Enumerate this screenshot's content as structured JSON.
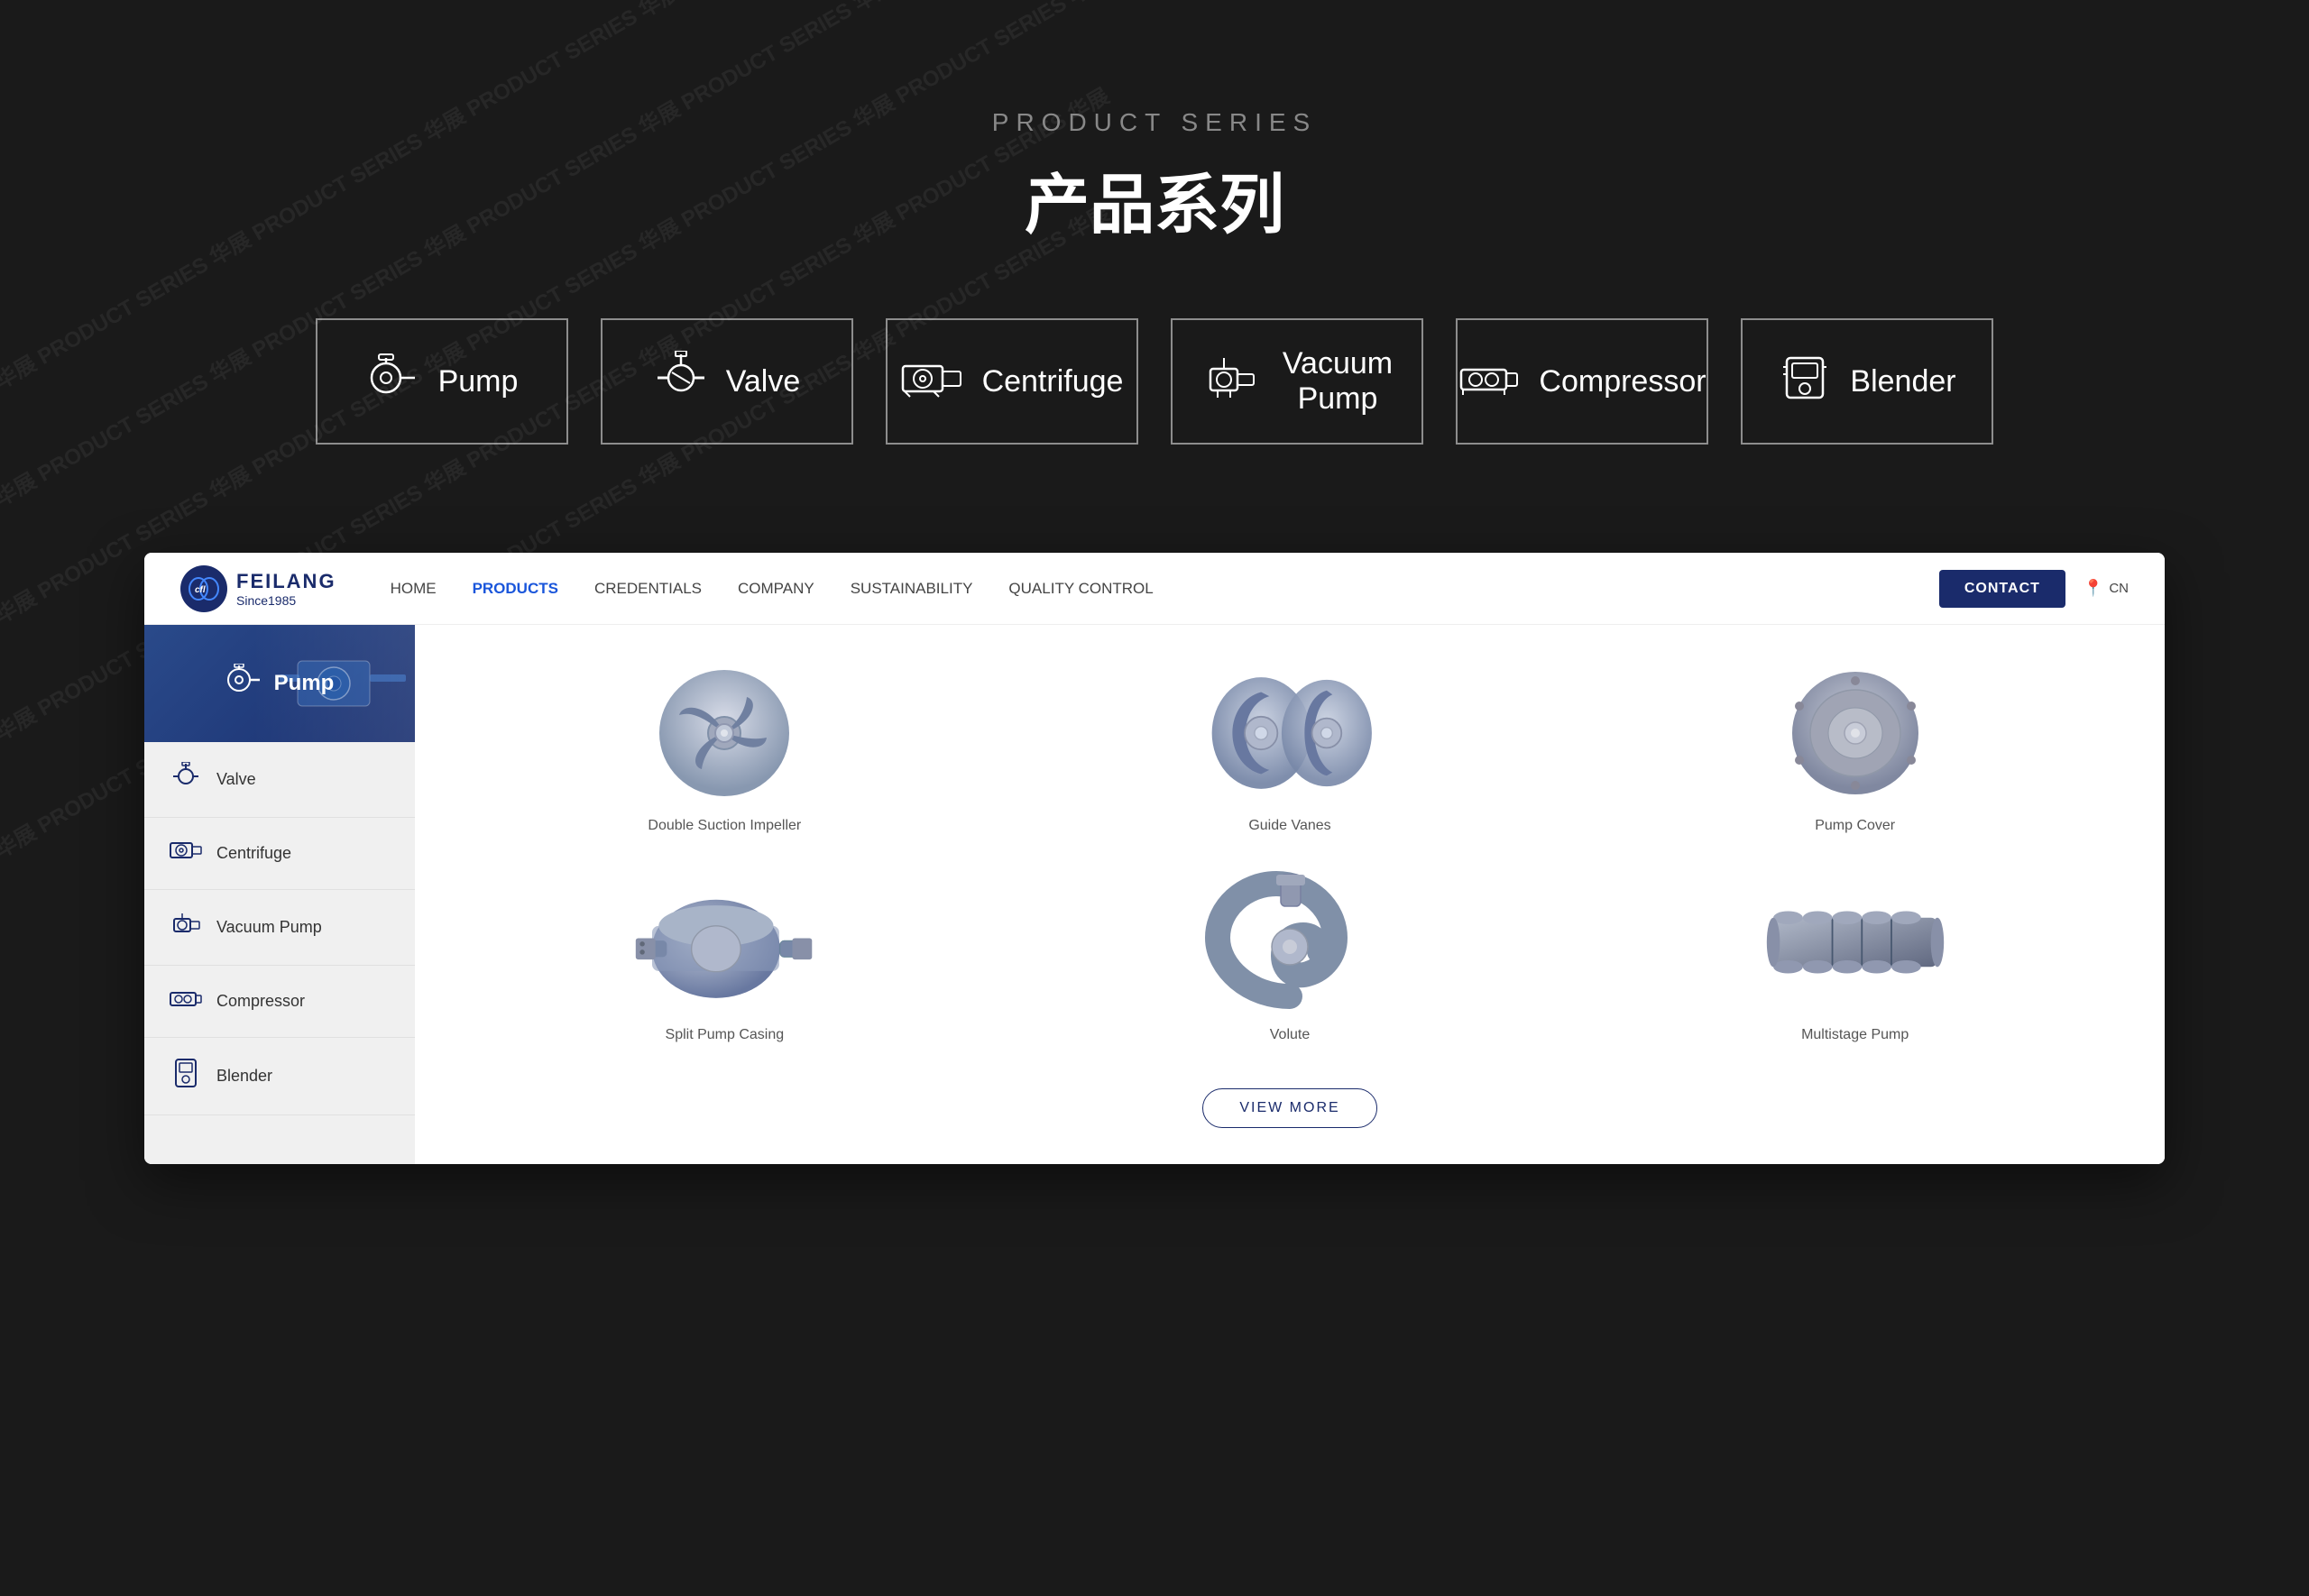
{
  "page": {
    "background_color": "#1a1a1a"
  },
  "top_section": {
    "subtitle": "PRODUCT SERIES",
    "title": "产品系列",
    "categories": [
      {
        "id": "pump",
        "label": "Pump",
        "icon": "⊙"
      },
      {
        "id": "valve",
        "label": "Valve",
        "icon": "✤"
      },
      {
        "id": "centrifuge",
        "label": "Centrifuge",
        "icon": "⊟"
      },
      {
        "id": "vacuum-pump",
        "label": "Vacuum\nPump",
        "icon": "⊞"
      },
      {
        "id": "compressor",
        "label": "Compressor",
        "icon": "⊠"
      },
      {
        "id": "blender",
        "label": "Blender",
        "icon": "⊡"
      }
    ]
  },
  "nav": {
    "logo_name": "FEILANG",
    "logo_since": "Since1985",
    "links": [
      {
        "label": "HOME",
        "active": false
      },
      {
        "label": "PRODUCTS",
        "active": true
      },
      {
        "label": "CREDENTIALS",
        "active": false
      },
      {
        "label": "COMPANY",
        "active": false
      },
      {
        "label": "SUSTAINABILITY",
        "active": false
      },
      {
        "label": "QUALITY CONTROL",
        "active": false
      }
    ],
    "contact_label": "CONTACT",
    "lang": "CN"
  },
  "sidebar": {
    "items": [
      {
        "id": "pump",
        "label": "Pump",
        "active": true
      },
      {
        "id": "valve",
        "label": "Valve",
        "active": false
      },
      {
        "id": "centrifuge",
        "label": "Centrifuge",
        "active": false
      },
      {
        "id": "vacuum-pump",
        "label": "Vacuum Pump",
        "active": false
      },
      {
        "id": "compressor",
        "label": "Compressor",
        "active": false
      },
      {
        "id": "blender",
        "label": "Blender",
        "active": false
      }
    ]
  },
  "products": {
    "items": [
      {
        "id": "double-suction-impeller",
        "label": "Double Suction Impeller"
      },
      {
        "id": "guide-vanes",
        "label": "Guide Vanes"
      },
      {
        "id": "pump-cover",
        "label": "Pump Cover"
      },
      {
        "id": "split-pump-casing",
        "label": "Split Pump Casing"
      },
      {
        "id": "volute",
        "label": "Volute"
      },
      {
        "id": "multistage-pump",
        "label": "Multistage Pump"
      }
    ],
    "view_more_label": "VIEW MORE"
  }
}
